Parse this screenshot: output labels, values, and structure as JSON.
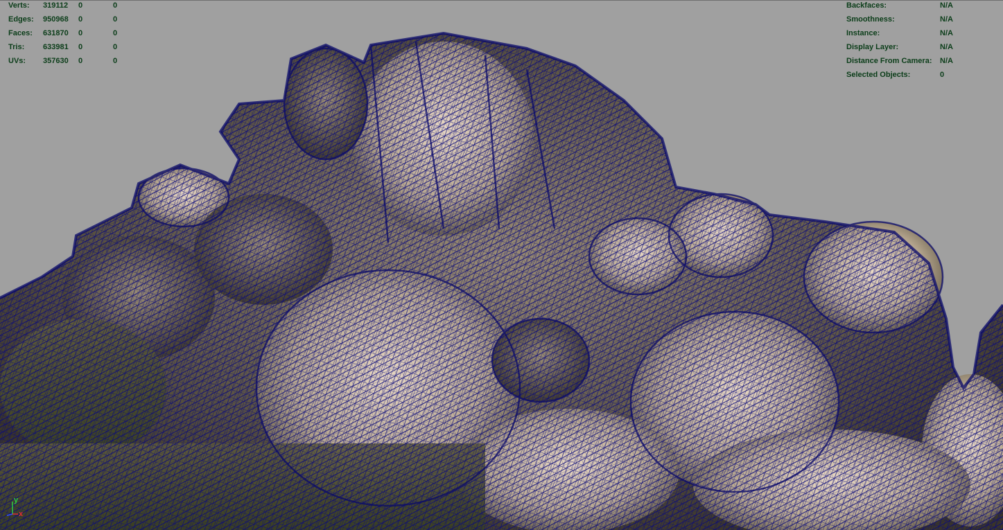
{
  "viewport": {
    "name": "perspective-viewport",
    "background": "#a0a0a0",
    "wire_color": "#0a0a7a"
  },
  "poly_count": [
    {
      "label": "Verts:",
      "values": [
        "319112",
        "0",
        "0"
      ]
    },
    {
      "label": "Edges:",
      "values": [
        "950968",
        "0",
        "0"
      ]
    },
    {
      "label": "Faces:",
      "values": [
        "631870",
        "0",
        "0"
      ]
    },
    {
      "label": "Tris:",
      "values": [
        "633981",
        "0",
        "0"
      ]
    },
    {
      "label": "UVs:",
      "values": [
        "357630",
        "0",
        "0"
      ]
    }
  ],
  "object_details": [
    {
      "label": "Backfaces:",
      "value": "N/A"
    },
    {
      "label": "Smoothness:",
      "value": "N/A"
    },
    {
      "label": "Instance:",
      "value": "N/A"
    },
    {
      "label": "Display Layer:",
      "value": "N/A"
    },
    {
      "label": "Distance From Camera:",
      "value": "N/A"
    },
    {
      "label": "Selected Objects:",
      "value": "0"
    }
  ],
  "axis_gizmo": {
    "y_label": "y",
    "x_label": "x",
    "y_color": "#2ecc40",
    "x_color": "#e03030",
    "z_color": "#3050ff"
  }
}
